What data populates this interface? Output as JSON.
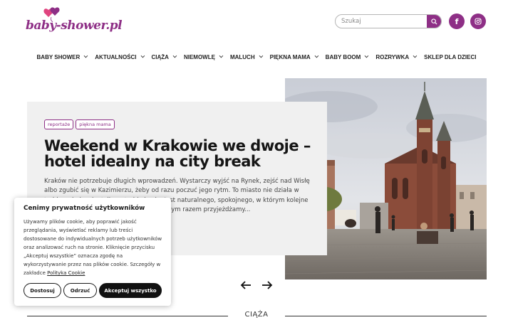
{
  "brand": {
    "logo_text": "baby-shower.pl",
    "accent_color": "#8e2f86"
  },
  "search": {
    "placeholder": "Szukaj",
    "button_icon": "search-icon"
  },
  "social": [
    {
      "name": "facebook",
      "icon": "facebook-icon",
      "glyph": "f"
    },
    {
      "name": "instagram",
      "icon": "instagram-icon"
    }
  ],
  "nav": {
    "items": [
      {
        "label": "BABY SHOWER",
        "dropdown": true
      },
      {
        "label": "AKTUALNOŚCI",
        "dropdown": true
      },
      {
        "label": "CIĄŻA",
        "dropdown": true
      },
      {
        "label": "NIEMOWLĘ",
        "dropdown": true
      },
      {
        "label": "MALUCH",
        "dropdown": true
      },
      {
        "label": "PIĘKNA MAMA",
        "dropdown": true
      },
      {
        "label": "BABY BOOM",
        "dropdown": true
      },
      {
        "label": "ROZRYWKA",
        "dropdown": true
      },
      {
        "label": "SKLEP DLA DZIECI",
        "dropdown": false
      }
    ]
  },
  "hero": {
    "tags": [
      "reportaże",
      "piękna mama"
    ],
    "title": "Weekend w Krakowie we dwoje – hotel idealny na city break",
    "excerpt": "Kraków nie potrzebuje długich wprowadzeń. Wystarczy wyjść na Rynek, zejść nad Wisłę albo zgubić się w Kazimierzu, żeby od razu poczuć jego rytm. To miasto nie działa w trybie zwiedzania, tylko w trybie bycia. Jest naturalnego, spokojnego, w którym kolejne przyjazdy są inne niż poprzednio. Za każdym razem przyjeżdżamy...",
    "image_alt": "Kraków Rynek Główny z Kościołem Mariackim"
  },
  "slider": {
    "prev_icon": "arrow-left-icon",
    "next_icon": "arrow-right-icon"
  },
  "section": {
    "title": "CIĄŻA"
  },
  "cookie": {
    "title": "Cenimy prywatność użytkowników",
    "text": "Używamy plików cookie, aby poprawić jakość przeglądania, wyświetlać reklamy lub treści dostosowane do indywidualnych potrzeb użytkowników oraz analizować ruch na stronie. Kliknięcie przycisku „Akceptuj wszystkie” oznacza zgodę na wykorzystywanie przez nas plików cookie. Szczegóły w zakładce",
    "link": "Polityka Cookie",
    "buttons": {
      "customize": "Dostosuj",
      "reject": "Odrzuć",
      "accept": "Akceptuj wszystko"
    }
  }
}
